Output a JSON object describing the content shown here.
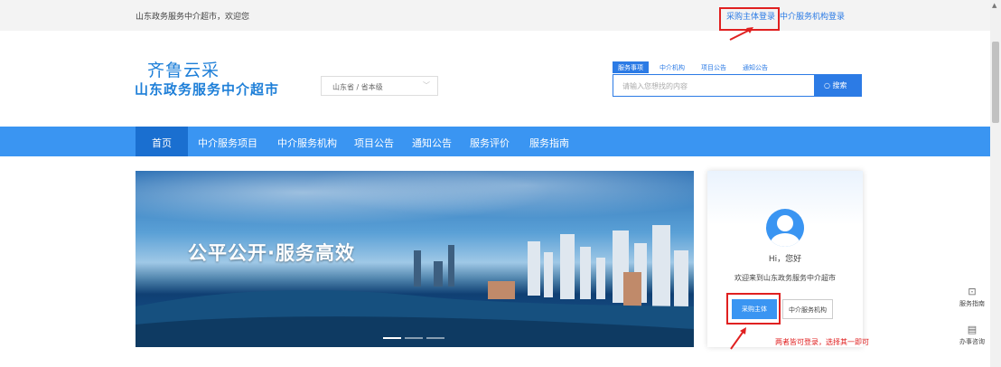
{
  "topbar": {
    "welcome": "山东政务服务中介超市，欢迎您",
    "buyer_login": "采购主体登录",
    "agency_login": "中介服务机构登录"
  },
  "header": {
    "logo_line1": "齐鲁云采",
    "logo_line2": "山东政务服务中介超市",
    "region_select": "山东省 / 省本级",
    "search_tabs": [
      "服务事项",
      "中介机构",
      "项目公告",
      "通知公告"
    ],
    "search_placeholder": "请输入您想找的内容",
    "search_button": "搜索"
  },
  "nav": {
    "items": [
      "首页",
      "中介服务项目",
      "中介服务机构",
      "项目公告",
      "通知公告",
      "服务评价",
      "服务指南"
    ]
  },
  "banner": {
    "slogan": "公平公开·服务高效"
  },
  "card": {
    "hello": "Hi，您好",
    "welcome": "欢迎来到山东政务服务中介超市",
    "buyer_button": "采购主体",
    "agency_button": "中介服务机构"
  },
  "annotation": {
    "note": "两者皆可登录，选择其一即可"
  },
  "float": {
    "guide": "服务指南",
    "consult": "办事咨询"
  },
  "colors": {
    "primary": "#3a95f2",
    "nav_active": "#1a6fd0",
    "annotation_red": "#e02020"
  }
}
